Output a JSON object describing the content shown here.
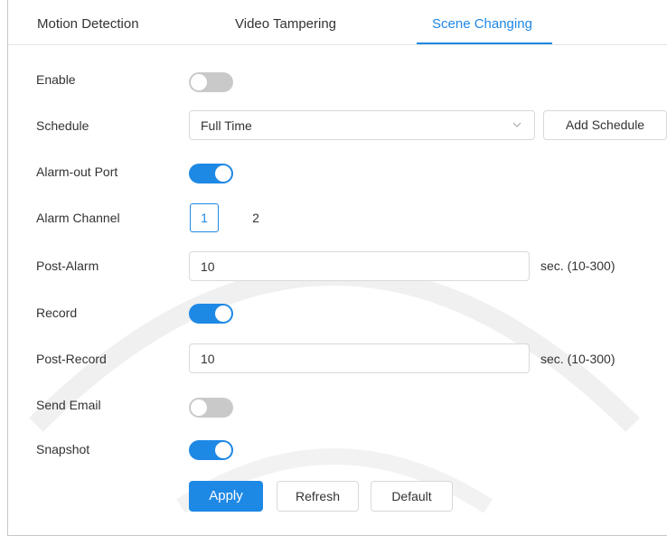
{
  "tabs": [
    {
      "label": "Motion Detection",
      "active": false
    },
    {
      "label": "Video Tampering",
      "active": false
    },
    {
      "label": "Scene Changing",
      "active": true
    }
  ],
  "form": {
    "enable": {
      "label": "Enable",
      "on": false
    },
    "schedule": {
      "label": "Schedule",
      "value": "Full Time",
      "add_button": "Add Schedule"
    },
    "alarm_out_port": {
      "label": "Alarm-out Port",
      "on": true
    },
    "alarm_channel": {
      "label": "Alarm Channel",
      "options": [
        "1",
        "2"
      ],
      "selected": "1"
    },
    "post_alarm": {
      "label": "Post-Alarm",
      "value": "10",
      "unit": "sec. (10-300)"
    },
    "record": {
      "label": "Record",
      "on": true
    },
    "post_record": {
      "label": "Post-Record",
      "value": "10",
      "unit": "sec. (10-300)"
    },
    "send_email": {
      "label": "Send Email",
      "on": false
    },
    "snapshot": {
      "label": "Snapshot",
      "on": true
    }
  },
  "actions": {
    "apply": "Apply",
    "refresh": "Refresh",
    "default": "Default"
  },
  "colors": {
    "accent": "#1e88e5",
    "toggle_off": "#c9c9c9",
    "border": "#d9d9d9"
  }
}
